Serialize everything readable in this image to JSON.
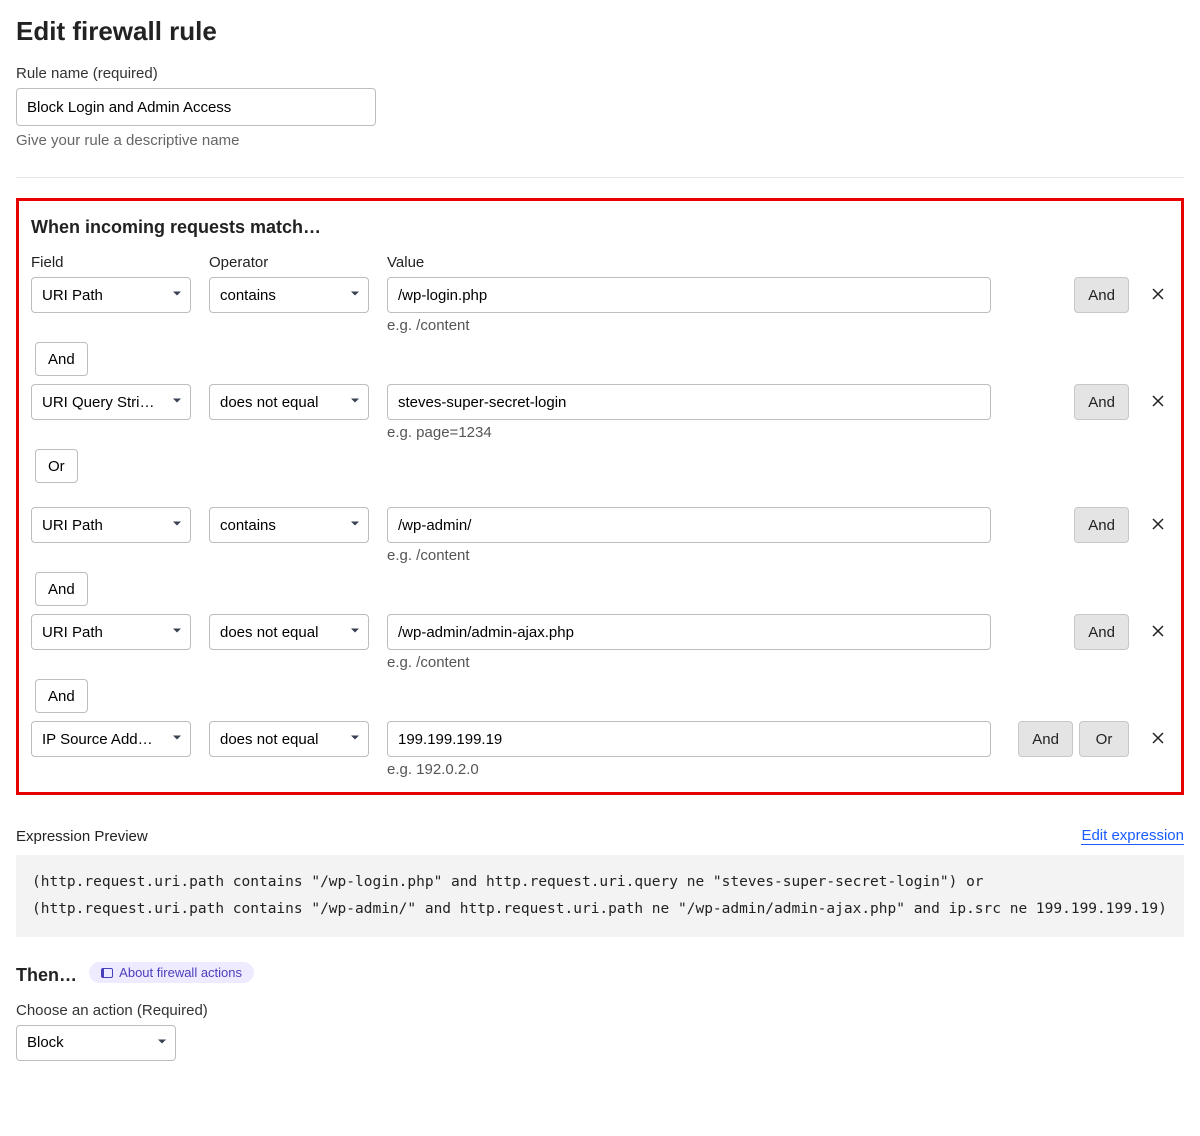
{
  "header": {
    "title": "Edit firewall rule"
  },
  "rule_name": {
    "label": "Rule name (required)",
    "value": "Block Login and Admin Access",
    "help": "Give your rule a descriptive name"
  },
  "match": {
    "heading": "When incoming requests match…",
    "col_field": "Field",
    "col_operator": "Operator",
    "col_value": "Value",
    "rows": [
      {
        "field": "URI Path",
        "op": "contains",
        "value": "/wp-login.php",
        "hint": "e.g. /content",
        "btns": [
          "And"
        ],
        "after": "And"
      },
      {
        "field": "URI Query Stri…",
        "op": "does not equal",
        "value": "steves-super-secret-login",
        "hint": "e.g. page=1234",
        "btns": [
          "And"
        ],
        "after": "Or"
      },
      {
        "field": "URI Path",
        "op": "contains",
        "value": "/wp-admin/",
        "hint": "e.g. /content",
        "btns": [
          "And"
        ],
        "after": "And"
      },
      {
        "field": "URI Path",
        "op": "does not equal",
        "value": "/wp-admin/admin-ajax.php",
        "hint": "e.g. /content",
        "btns": [
          "And"
        ],
        "after": "And"
      },
      {
        "field": "IP Source Add…",
        "op": "does not equal",
        "value": "199.199.199.19",
        "hint": "e.g. 192.0.2.0",
        "btns": [
          "And",
          "Or"
        ],
        "after": null
      }
    ]
  },
  "preview": {
    "label": "Expression Preview",
    "edit_link": "Edit expression",
    "code": "(http.request.uri.path contains \"/wp-login.php\" and http.request.uri.query ne \"steves-super-secret-login\") or (http.request.uri.path contains \"/wp-admin/\" and http.request.uri.path ne \"/wp-admin/admin-ajax.php\" and ip.src ne 199.199.199.19)"
  },
  "then": {
    "heading": "Then…",
    "pill": "About firewall actions",
    "choose_label": "Choose an action (Required)",
    "action": "Block"
  }
}
